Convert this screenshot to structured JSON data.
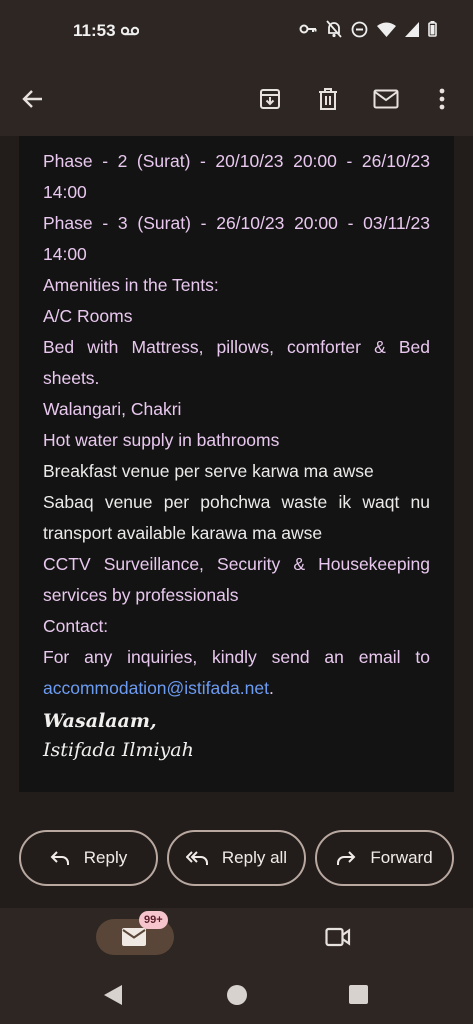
{
  "status_bar": {
    "time": "11:53"
  },
  "app_bar": {
    "back": "arrow-back-icon",
    "actions": [
      "archive-icon",
      "delete-icon",
      "mark-unread-icon",
      "more-vert-icon"
    ]
  },
  "email": {
    "lines": [
      "Phase - 2 (Surat) - 20/10/23 20:00 - 26/10/23 14:00",
      "Phase - 3 (Surat) - 26/10/23 20:00 - 03/11/23 14:00",
      "Amenities in the Tents:",
      "A/C Rooms",
      "Bed with Mattress, pillows, comforter & Bed sheets.",
      "Walangari, Chakri",
      "Hot water supply in bathrooms",
      "Breakfast venue per serve karwa ma awse",
      "Sabaq venue per pohchwa waste ik waqt nu transport available karawa ma awse",
      "CCTV Surveillance, Security & Housekeeping services by professionals",
      "Contact:"
    ],
    "contact_prefix": "For any inquiries, kindly send an email to",
    "contact_email": "accommodation@istifada.net",
    "contact_suffix": ".",
    "signoff_salutation": "Wasalaam,",
    "signoff_name": "Istifada Ilmiyah"
  },
  "actions": {
    "reply": "Reply",
    "reply_all": "Reply all",
    "forward": "Forward"
  },
  "bottom_nav": {
    "mail_badge": "99+"
  },
  "colors": {
    "pink_text": "#e8c8ee",
    "link": "#6c9bf2",
    "background": "#221d1a"
  }
}
